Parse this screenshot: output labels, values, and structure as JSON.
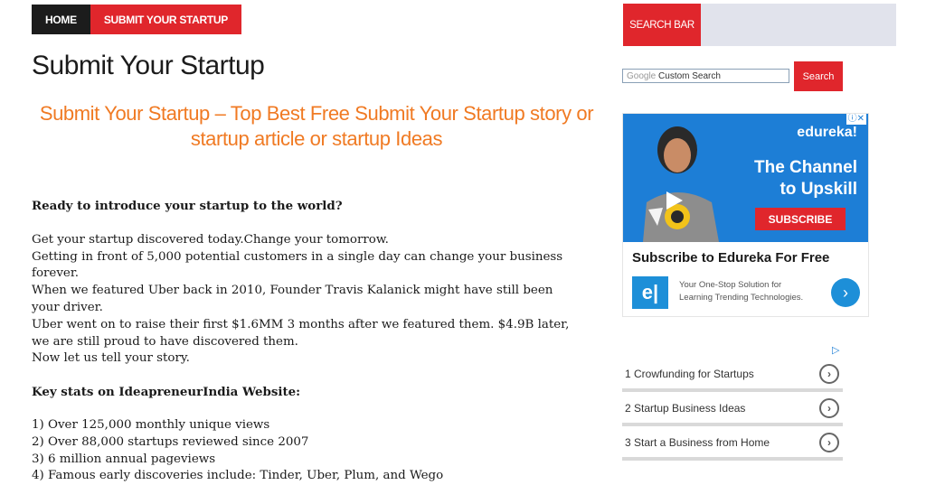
{
  "nav": {
    "home": "HOME",
    "submit": "SUBMIT YOUR STARTUP"
  },
  "page_title": "Submit Your Startup",
  "subtitle": "Submit Your Startup – Top Best Free Submit Your Startup story or startup article or startup Ideas",
  "content": {
    "question": "Ready to introduce your startup to the world?",
    "paragraph_lines": [
      "Get your startup discovered today.Change your tomorrow.",
      "Getting in front of 5,000 potential customers in a single day can change your business forever.",
      "When we featured Uber back in 2010, Founder Travis Kalanick might have still been your driver.",
      "Uber went on to raise their first $1.6MM 3 months after we featured them. $4.9B later, we are still proud to have discovered them.",
      "Now let us tell your story."
    ],
    "stats_heading": "Key stats on IdeapreneurIndia Website:",
    "stats": [
      "1) Over 125,000 monthly unique views",
      "2) Over 88,000 startups reviewed since 2007",
      "3) 6 million annual pageviews",
      "4) Famous early discoveries include: Tinder, Uber, Plum, and Wego"
    ]
  },
  "sidebar": {
    "search_bar_label": "SEARCH BAR",
    "search_brand": "Google",
    "search_placeholder": "Custom Search",
    "search_button": "Search",
    "ad": {
      "info": "ⓘ✕",
      "brand": "edureka!",
      "headline_1": "The Channel",
      "headline_2": "to Upskill",
      "subscribe": "SUBSCRIBE",
      "title": "Subscribe to Edureka For Free",
      "logo": "e|",
      "desc_1": "Your One-Stop Solution for",
      "desc_2": "Learning Trending Technologies."
    },
    "adchoice": "▷",
    "links": [
      "1 Crowfunding for Startups",
      "2 Startup Business Ideas",
      "3 Start a Business from Home"
    ]
  },
  "colors": {
    "accent_red": "#e0262c",
    "orange": "#f07a23",
    "ad_blue": "#1d7ed6"
  }
}
